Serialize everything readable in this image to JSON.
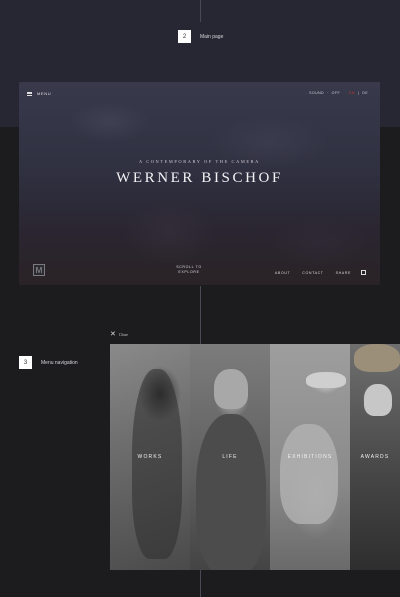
{
  "steps": [
    {
      "number": "2",
      "label": "Main page"
    },
    {
      "number": "3",
      "label": "Menu navigation"
    }
  ],
  "hero": {
    "menu_label": "MENU",
    "sound_label": "SOUND",
    "sound_state": "OFF",
    "lang_active": "EN",
    "lang_other": "DE",
    "subtitle": "A CONTEMPORARY OF THE CAMERA",
    "title": "WERNER BISCHOF",
    "logo_letter": "M",
    "explore_label": "SCROLL TO EXPLORE",
    "links": [
      "ABOUT",
      "CONTACT",
      "SHARE"
    ]
  },
  "menu_nav": {
    "close_label": "Close",
    "panels": [
      "WORKS",
      "LIFE",
      "EXHIBITIONS",
      "AWARDS"
    ]
  },
  "colors": {
    "accent": "#c0392b",
    "background": "#1c1c1e",
    "top_band": "#272733"
  }
}
